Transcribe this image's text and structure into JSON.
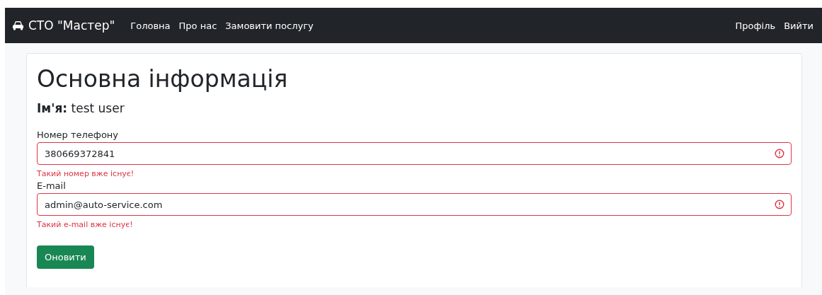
{
  "navbar": {
    "brand": "СТО \"Мастер\"",
    "links": [
      "Головна",
      "Про нас",
      "Замовити послугу"
    ],
    "right_links": [
      "Профіль",
      "Вийти"
    ]
  },
  "card": {
    "title": "Основна інформація",
    "name_line": "**Ім'я:** test user",
    "fields": [
      {
        "label": "Номер телефону",
        "value": "380669372841",
        "invalid": true,
        "error": "Такий номер вже існує!"
      },
      {
        "label": "E-mail",
        "value": "admin@auto-service.com",
        "invalid": true,
        "error": "Такий e-mail вже існує!"
      }
    ],
    "button": "Оновити"
  }
}
